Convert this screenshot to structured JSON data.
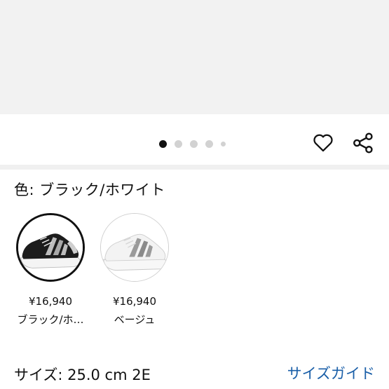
{
  "carousel": {
    "dot_count": 5,
    "active_index": 0
  },
  "actions": {
    "favorite_icon": "heart-icon",
    "share_icon": "share-icon"
  },
  "color": {
    "label": "色: ブラック/ホワイト"
  },
  "variants": [
    {
      "price": "¥16,940",
      "name": "ブラック/ホ…",
      "selected": true
    },
    {
      "price": "¥16,940",
      "name": "ベージュ",
      "selected": false
    }
  ],
  "size": {
    "label": "サイズ: 25.0 cm 2E",
    "guide_link": "サイズガイド"
  },
  "colors": {
    "background": "#ffffff",
    "image_area": "#f2f2f2",
    "link": "#1a5fa8",
    "active_dot": "#111111"
  }
}
